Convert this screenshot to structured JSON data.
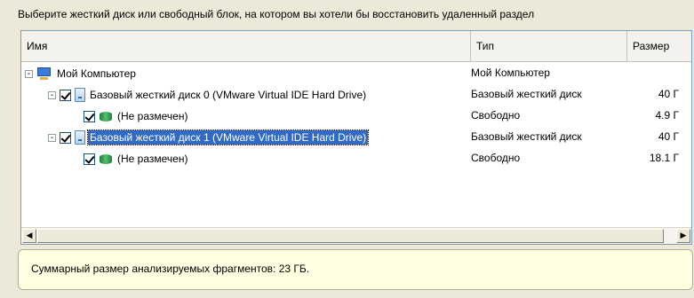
{
  "instruction": "Выберите жесткий диск или свободный блок, на котором вы хотели бы восстановить удаленный раздел",
  "columns": {
    "name": "Имя",
    "type": "Тип",
    "size": "Размер"
  },
  "tree": [
    {
      "name": "Мой Компьютер",
      "type": "Мой Компьютер",
      "size": "",
      "icon": "computer-icon",
      "level": 0,
      "checkbox": false,
      "expander": "-"
    },
    {
      "name": "Базовый жесткий диск 0 (VMware Virtual IDE Hard Drive)",
      "type": "Базовый жесткий диск",
      "size": "40 Г",
      "icon": "hard-disk-icon",
      "level": 1,
      "checkbox": true,
      "checked": true,
      "expander": "-"
    },
    {
      "name": "(Не размечен)",
      "type": "Свободно",
      "size": "4.9 Г",
      "icon": "partition-icon",
      "level": 2,
      "checkbox": true,
      "checked": true
    },
    {
      "name": "Базовый жесткий диск 1 (VMware Virtual IDE Hard Drive)",
      "type": "Базовый жесткий диск",
      "size": "40 Г",
      "icon": "hard-disk-icon",
      "level": 1,
      "checkbox": true,
      "checked": true,
      "expander": "-",
      "selected": true
    },
    {
      "name": "(Не размечен)",
      "type": "Свободно",
      "size": "18.1 Г",
      "icon": "partition-icon",
      "level": 2,
      "checkbox": true,
      "checked": true
    }
  ],
  "scrollbar": {
    "left_icon": "◀",
    "right_icon": "▶"
  },
  "summary": "Суммарный размер анализируемых фрагментов: 23 ГБ.",
  "colors": {
    "selection": "#316ac5",
    "summary_bg": "#ffffe1"
  }
}
